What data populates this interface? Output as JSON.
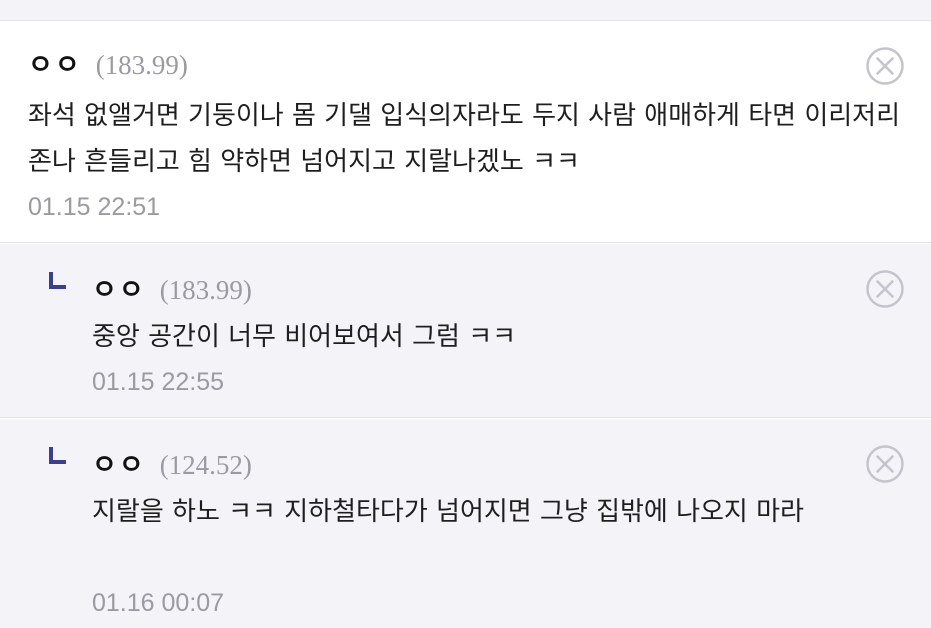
{
  "comments": [
    {
      "nick": "ㅇㅇ",
      "ip": "(183.99)",
      "body": "좌석 없앨거면 기둥이나 몸 기댈 입식의자라도 두지 사람 애매하게 타면 이리저리 존나 흔들리고 힘 약하면 넘어지고 지랄나겠노 ㅋㅋ",
      "time": "01.15 22:51"
    }
  ],
  "replies": [
    {
      "nick": "ㅇㅇ",
      "ip": "(183.99)",
      "body": "중앙 공간이 너무 비어보여서 그럼 ㅋㅋ",
      "time": "01.15 22:55"
    },
    {
      "nick": "ㅇㅇ",
      "ip": "(124.52)",
      "body": "지랄을 하노 ㅋㅋ 지하철타다가 넘어지면 그냥 집밖에 나오지 마라",
      "time": "01.16 00:07"
    }
  ],
  "colors": {
    "reply_bg": "#f4f4f8",
    "divider": "#e2e2ea",
    "meta_gray": "#9a9aa2",
    "reply_mark": "#3b3f8c",
    "delete_icon": "#c4c4cc"
  },
  "icons": {
    "delete": "circle-x-icon",
    "reply": "reply-corner-icon"
  }
}
